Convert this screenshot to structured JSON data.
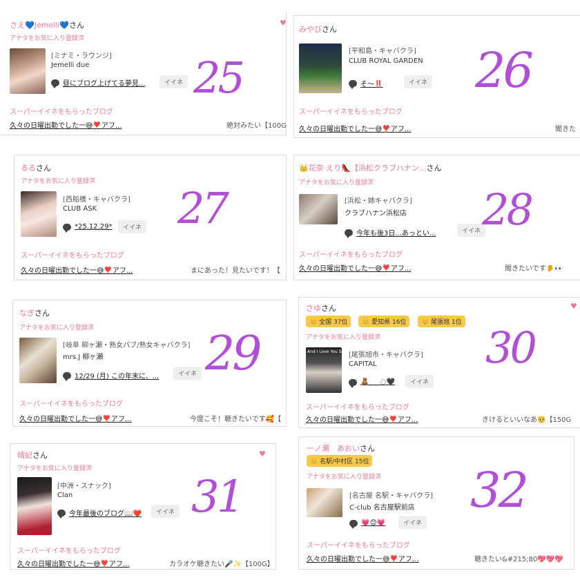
{
  "common": {
    "fav_label": "アナタをお気に入り登録済",
    "iine_label": "イイネ",
    "super_label": "スーパーイイネをもらったブログ"
  },
  "colors": {
    "accent_pink": "#e77a9b",
    "badge_yellow": "#f6c94a",
    "handwriting_purple": "#b14fd6"
  },
  "cards": [
    {
      "name": "さえ💙Jemelli💙",
      "suffix": "さん",
      "shop": "[ミナミ・ラウンジ]",
      "club": "Jemelli due",
      "blog": "昼にブログ上げてる夢見...",
      "featured_blog": "久々の日曜出勤でした一😅❣️アフ...",
      "comment": "絶対みたい【100G",
      "number": "25",
      "heart": "♥"
    },
    {
      "name": "みやび",
      "suffix": "さん",
      "shop": "[平和島・キャバクラ]",
      "club": "CLUB ROYAL GARDEN",
      "blog": "そ〜‼️",
      "featured_blog": "久々の日曜出勤でした一😅❣️アフ...",
      "comment": "聞きた",
      "number": "26"
    },
    {
      "name": "るる",
      "suffix": "さん",
      "shop": "[西船橋・キャバクラ]",
      "club": "CLUB ASK",
      "blog": "*25.12.29*",
      "featured_blog": "久々の日曜出勤でした一😅❣️アフ...",
      "comment": "まにあった！見たいです！【",
      "number": "27"
    },
    {
      "name": "👑花奈 えり👠【浜松クラブハナン...",
      "suffix": "さん",
      "shop": "[浜松・姉キャバクラ]",
      "club": "クラブハナン浜松店",
      "blog": "今年も後3日...あっとい...",
      "featured_blog": "久々の日曜出勤でした一😅❣️アフ...",
      "comment": "聞きたいです👂👀",
      "number": "28"
    },
    {
      "name": "なぎ",
      "suffix": "さん",
      "shop": "[岐阜 柳ヶ瀬・熟女パブ/熟女キャバクラ]",
      "club": "mrs.J 柳ヶ瀬",
      "blog": "12/29 (月) この年末に、...",
      "featured_blog": "久々の日曜出勤でした一😅❣️アフ...",
      "comment": "今度こそ！聴きたいです🥰【",
      "number": "29"
    },
    {
      "name": "さゆ",
      "suffix": "さん",
      "shop": "[尾張旭市・キャバクラ]",
      "club": "CAPITAL",
      "blog": "🧸_ _ ◌🖤",
      "featured_blog": "久々の日曜出勤でした一😅❣️アフ...",
      "comment": "きけるといいなあ🥺【150G",
      "badges": [
        {
          "label": "全国",
          "rank": "37位"
        },
        {
          "label": "愛知県",
          "rank": "16位"
        },
        {
          "label": "尾張旭",
          "rank": "1位"
        }
      ],
      "thumb_text": "And I Love You So.",
      "number": "30",
      "heart": "♥"
    },
    {
      "name": "晴妃",
      "suffix": "さん",
      "shop": "[中洲・スナック]",
      "club": "Clan",
      "blog": "今年最後のブログ📖❤️",
      "featured_blog": "久々の日曜出勤でした一😅❣️アフ...",
      "comment": "カラオケ聴きたい🎤✨【100G】",
      "number": "31",
      "heart": "♥"
    },
    {
      "name": "一ノ瀬　あおい",
      "suffix": "さん",
      "shop": "[名古屋 名駅・キャバクラ]",
      "club": "C-club 名古屋駅前店",
      "blog": "💗😊💗",
      "featured_blog": "久々の日曜出勤でした一😅❣️アフ...",
      "comment": "聴きたい&#215;80💖💖💖",
      "badges": [
        {
          "label": "名駅/中村区",
          "rank": "15位"
        }
      ],
      "number": "32"
    }
  ]
}
